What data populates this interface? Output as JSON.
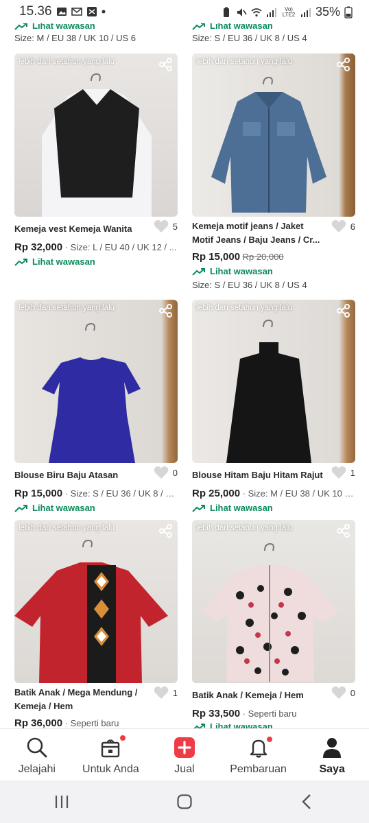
{
  "status_bar": {
    "time": "15.36",
    "left_icons": [
      "image-icon",
      "gmail-icon",
      "shortcut-icon",
      "dot-icon"
    ],
    "right_icons": [
      "battery-saver-icon",
      "mute-icon",
      "wifi-icon",
      "signal-icon",
      "volte-icon",
      "signal-2-icon",
      "battery-icon"
    ],
    "volte_label": "Vo) LTE2",
    "battery_percent": "35%"
  },
  "partial_row": [
    {
      "insight_label": "Lihat wawasan",
      "size": "Size: M / EU 38 / UK 10 / US 6"
    },
    {
      "insight_label": "Lihat wawasan",
      "size": "Size: S / EU 36 / UK 8 / US 4"
    }
  ],
  "products": [
    {
      "timestamp": "lebih dari setahun yang lalu",
      "title": "Kemeja vest Kemeja Wanita",
      "likes": "5",
      "price": "Rp 32,000",
      "price_suffix": " · Size: L / EU 40 / UK 12 / ...",
      "old_price": "",
      "insight_label": "Lihat wawasan",
      "size": ""
    },
    {
      "timestamp": "lebih dari setahun yang lalu",
      "title": "Kemeja motif jeans / Jaket Motif Jeans / Baju Jeans / Cr...",
      "likes": "6",
      "price": "Rp 15,000",
      "price_suffix": "",
      "old_price": "Rp 20,000",
      "insight_label": "Lihat wawasan",
      "size": "Size: S / EU 36 / UK 8 / US 4"
    },
    {
      "timestamp": "lebih dari setahun yang lalu",
      "title": "Blouse Biru Baju Atasan",
      "likes": "0",
      "price": "Rp 15,000",
      "price_suffix": " · Size: S / EU 36 / UK 8 / U...",
      "old_price": "",
      "insight_label": "Lihat wawasan",
      "size": ""
    },
    {
      "timestamp": "lebih dari setahun yang lalu",
      "title": "Blouse Hitam Baju Hitam Rajut",
      "likes": "1",
      "price": "Rp 25,000",
      "price_suffix": " · Size: M / EU 38 / UK 10 / ...",
      "old_price": "",
      "insight_label": "Lihat wawasan",
      "size": ""
    },
    {
      "timestamp": "lebih dari setahun yang lalu",
      "title": "Batik Anak / Mega Mendung / Kemeja / Hem",
      "likes": "1",
      "price": "Rp 36,000",
      "price_suffix": " · Seperti baru",
      "old_price": "",
      "insight_label": "",
      "size": ""
    },
    {
      "timestamp": "lebih dari setahun yang lalu",
      "title": "Batik Anak / Kemeja / Hem",
      "likes": "0",
      "price": "Rp 33,500",
      "price_suffix": " · Seperti baru",
      "old_price": "",
      "insight_label": "Lihat wawasan",
      "size": ""
    }
  ],
  "bottom_nav": [
    {
      "label": "Jelajahi",
      "icon": "search-icon",
      "badge": false,
      "active": false
    },
    {
      "label": "Untuk Anda",
      "icon": "gift-icon",
      "badge": true,
      "active": false
    },
    {
      "label": "Jual",
      "icon": "plus-icon",
      "badge": false,
      "active": false
    },
    {
      "label": "Pembaruan",
      "icon": "bell-icon",
      "badge": true,
      "active": false
    },
    {
      "label": "Saya",
      "icon": "user-icon",
      "badge": false,
      "active": true
    }
  ],
  "system_nav": [
    "recents-icon",
    "home-icon",
    "back-icon"
  ],
  "colors": {
    "insight_green": "#0b8a5a",
    "accent_red": "#ef3b45",
    "text_dark": "#222222"
  }
}
